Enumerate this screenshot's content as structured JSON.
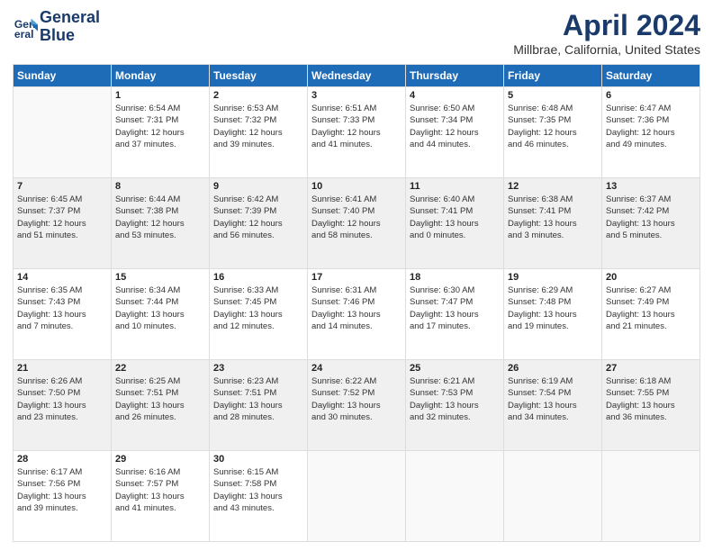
{
  "logo": {
    "line1": "General",
    "line2": "Blue"
  },
  "title": "April 2024",
  "subtitle": "Millbrae, California, United States",
  "days_of_week": [
    "Sunday",
    "Monday",
    "Tuesday",
    "Wednesday",
    "Thursday",
    "Friday",
    "Saturday"
  ],
  "weeks": [
    [
      {
        "day": "",
        "info": ""
      },
      {
        "day": "1",
        "info": "Sunrise: 6:54 AM\nSunset: 7:31 PM\nDaylight: 12 hours\nand 37 minutes."
      },
      {
        "day": "2",
        "info": "Sunrise: 6:53 AM\nSunset: 7:32 PM\nDaylight: 12 hours\nand 39 minutes."
      },
      {
        "day": "3",
        "info": "Sunrise: 6:51 AM\nSunset: 7:33 PM\nDaylight: 12 hours\nand 41 minutes."
      },
      {
        "day": "4",
        "info": "Sunrise: 6:50 AM\nSunset: 7:34 PM\nDaylight: 12 hours\nand 44 minutes."
      },
      {
        "day": "5",
        "info": "Sunrise: 6:48 AM\nSunset: 7:35 PM\nDaylight: 12 hours\nand 46 minutes."
      },
      {
        "day": "6",
        "info": "Sunrise: 6:47 AM\nSunset: 7:36 PM\nDaylight: 12 hours\nand 49 minutes."
      }
    ],
    [
      {
        "day": "7",
        "info": "Sunrise: 6:45 AM\nSunset: 7:37 PM\nDaylight: 12 hours\nand 51 minutes."
      },
      {
        "day": "8",
        "info": "Sunrise: 6:44 AM\nSunset: 7:38 PM\nDaylight: 12 hours\nand 53 minutes."
      },
      {
        "day": "9",
        "info": "Sunrise: 6:42 AM\nSunset: 7:39 PM\nDaylight: 12 hours\nand 56 minutes."
      },
      {
        "day": "10",
        "info": "Sunrise: 6:41 AM\nSunset: 7:40 PM\nDaylight: 12 hours\nand 58 minutes."
      },
      {
        "day": "11",
        "info": "Sunrise: 6:40 AM\nSunset: 7:41 PM\nDaylight: 13 hours\nand 0 minutes."
      },
      {
        "day": "12",
        "info": "Sunrise: 6:38 AM\nSunset: 7:41 PM\nDaylight: 13 hours\nand 3 minutes."
      },
      {
        "day": "13",
        "info": "Sunrise: 6:37 AM\nSunset: 7:42 PM\nDaylight: 13 hours\nand 5 minutes."
      }
    ],
    [
      {
        "day": "14",
        "info": "Sunrise: 6:35 AM\nSunset: 7:43 PM\nDaylight: 13 hours\nand 7 minutes."
      },
      {
        "day": "15",
        "info": "Sunrise: 6:34 AM\nSunset: 7:44 PM\nDaylight: 13 hours\nand 10 minutes."
      },
      {
        "day": "16",
        "info": "Sunrise: 6:33 AM\nSunset: 7:45 PM\nDaylight: 13 hours\nand 12 minutes."
      },
      {
        "day": "17",
        "info": "Sunrise: 6:31 AM\nSunset: 7:46 PM\nDaylight: 13 hours\nand 14 minutes."
      },
      {
        "day": "18",
        "info": "Sunrise: 6:30 AM\nSunset: 7:47 PM\nDaylight: 13 hours\nand 17 minutes."
      },
      {
        "day": "19",
        "info": "Sunrise: 6:29 AM\nSunset: 7:48 PM\nDaylight: 13 hours\nand 19 minutes."
      },
      {
        "day": "20",
        "info": "Sunrise: 6:27 AM\nSunset: 7:49 PM\nDaylight: 13 hours\nand 21 minutes."
      }
    ],
    [
      {
        "day": "21",
        "info": "Sunrise: 6:26 AM\nSunset: 7:50 PM\nDaylight: 13 hours\nand 23 minutes."
      },
      {
        "day": "22",
        "info": "Sunrise: 6:25 AM\nSunset: 7:51 PM\nDaylight: 13 hours\nand 26 minutes."
      },
      {
        "day": "23",
        "info": "Sunrise: 6:23 AM\nSunset: 7:51 PM\nDaylight: 13 hours\nand 28 minutes."
      },
      {
        "day": "24",
        "info": "Sunrise: 6:22 AM\nSunset: 7:52 PM\nDaylight: 13 hours\nand 30 minutes."
      },
      {
        "day": "25",
        "info": "Sunrise: 6:21 AM\nSunset: 7:53 PM\nDaylight: 13 hours\nand 32 minutes."
      },
      {
        "day": "26",
        "info": "Sunrise: 6:19 AM\nSunset: 7:54 PM\nDaylight: 13 hours\nand 34 minutes."
      },
      {
        "day": "27",
        "info": "Sunrise: 6:18 AM\nSunset: 7:55 PM\nDaylight: 13 hours\nand 36 minutes."
      }
    ],
    [
      {
        "day": "28",
        "info": "Sunrise: 6:17 AM\nSunset: 7:56 PM\nDaylight: 13 hours\nand 39 minutes."
      },
      {
        "day": "29",
        "info": "Sunrise: 6:16 AM\nSunset: 7:57 PM\nDaylight: 13 hours\nand 41 minutes."
      },
      {
        "day": "30",
        "info": "Sunrise: 6:15 AM\nSunset: 7:58 PM\nDaylight: 13 hours\nand 43 minutes."
      },
      {
        "day": "",
        "info": ""
      },
      {
        "day": "",
        "info": ""
      },
      {
        "day": "",
        "info": ""
      },
      {
        "day": "",
        "info": ""
      }
    ]
  ]
}
